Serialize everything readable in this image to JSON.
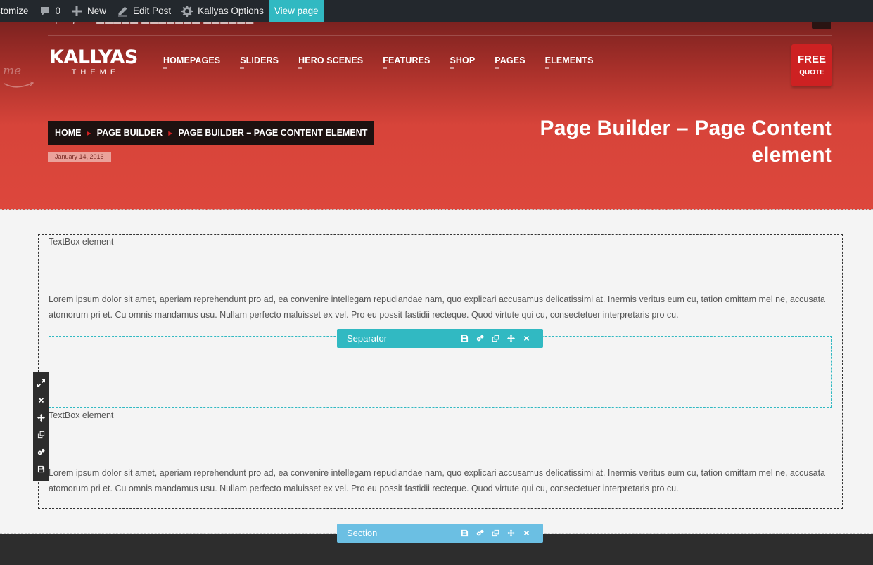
{
  "adminbar": {
    "items": [
      {
        "label": "stomize",
        "icon": ""
      },
      {
        "label": "0",
        "icon": "comment-icon"
      },
      {
        "label": "New",
        "icon": "plus-icon"
      },
      {
        "label": "Edit Post",
        "icon": "pencil-icon"
      },
      {
        "label": "Kallyas Options",
        "icon": "gear-icon"
      },
      {
        "label": "View page",
        "icon": ""
      }
    ],
    "accent": "#31b9c2"
  },
  "header": {
    "welcome_text": "me",
    "logo_main": "KALLYAS",
    "logo_sub": "THEME",
    "nav": [
      "HOMEPAGES",
      "SLIDERS",
      "HERO SCENES",
      "FEATURES",
      "SHOP",
      "PAGES",
      "ELEMENTS"
    ],
    "free_quote_line1": "FREE",
    "free_quote_line2": "QUOTE",
    "brand_red": "#cd2122"
  },
  "breadcrumb": [
    "HOME",
    "PAGE BUILDER",
    "PAGE BUILDER – PAGE CONTENT ELEMENT"
  ],
  "date": "January 14, 2016",
  "page_title": "Page Builder – Page Content element",
  "content": {
    "textbox1_label": "TextBox element",
    "textbox1_text": "Lorem ipsum dolor sit amet, aperiam reprehendunt pro ad, ea convenire intellegam repudiandae nam, quo explicari accusamus delicatissimi at. Inermis veritus eum cu, tation omittam mel ne, accusata atomorum pri et. Cu omnis mandamus usu. Nullam perfecto maluisset ex vel. Pro eu possit fastidii recteque. Quod virtute qui cu, consectetuer interpretaris pro cu.",
    "separator_label": "Separator",
    "textbox2_label": "TextBox element",
    "textbox2_text": "Lorem ipsum dolor sit amet, aperiam reprehendunt pro ad, ea convenire intellegam repudiandae nam, quo explicari accusamus delicatissimi at. Inermis veritus eum cu, tation omittam mel ne, accusata atomorum pri et. Cu omnis mandamus usu. Nullam perfecto maluisset ex vel. Pro eu possit fastidii recteque. Quod virtute qui cu, consectetuer interpretaris pro cu.",
    "section_label": "Section"
  },
  "element_tools": [
    "save-icon",
    "settings-icon",
    "clone-icon",
    "move-icon",
    "delete-icon"
  ],
  "column_tools": [
    "resize-icon",
    "delete-icon",
    "move-icon",
    "clone-icon",
    "settings-icon",
    "save-icon"
  ]
}
